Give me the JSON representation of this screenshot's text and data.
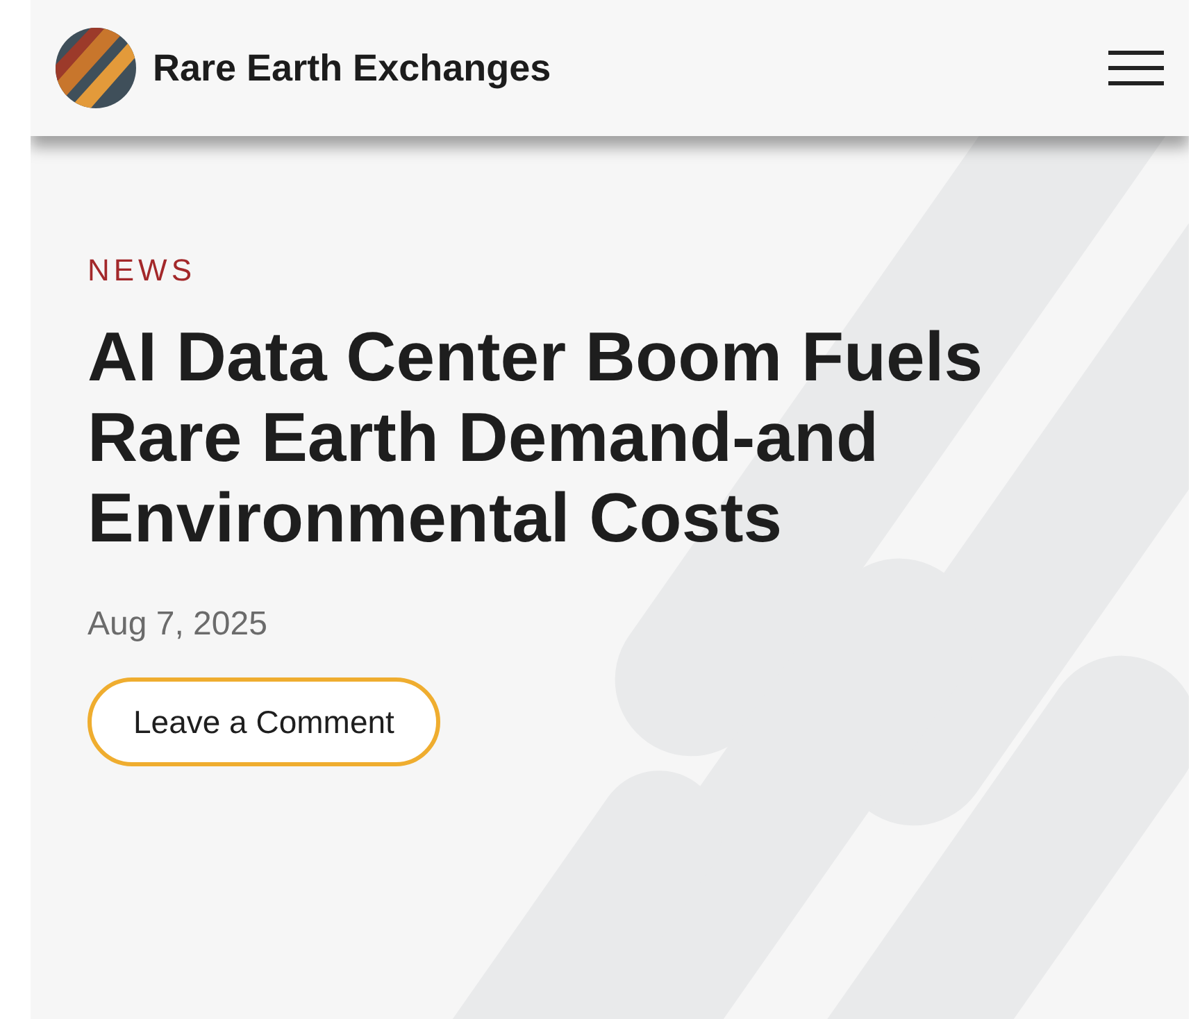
{
  "header": {
    "site_name": "Rare Earth Exchanges"
  },
  "article": {
    "category": "NEWS",
    "title": "AI Data Center Boom Fuels Rare Earth Demand-and Environmental Costs",
    "date": "Aug 7, 2025",
    "comment_button": "Leave a Comment"
  }
}
